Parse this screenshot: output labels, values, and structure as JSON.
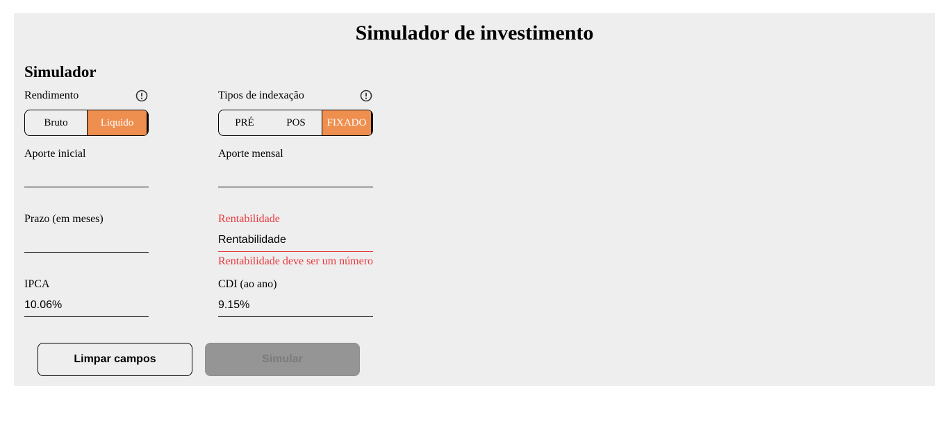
{
  "header": {
    "title": "Simulador de investimento"
  },
  "simulator": {
    "section_title": "Simulador",
    "rendimento": {
      "label": "Rendimento",
      "options": [
        "Bruto",
        "Liquido"
      ],
      "selected": "Liquido"
    },
    "indexacao": {
      "label": "Tipos de indexação",
      "options": [
        "PRÉ",
        "POS",
        "FIXADO"
      ],
      "selected": "FIXADO"
    },
    "fields": {
      "aporte_inicial": {
        "label": "Aporte inicial",
        "value": ""
      },
      "aporte_mensal": {
        "label": "Aporte mensal",
        "value": ""
      },
      "prazo": {
        "label": "Prazo (em meses)",
        "value": ""
      },
      "rentabilidade": {
        "label": "Rentabilidade",
        "value": "Rentabilidade",
        "error": "Rentabilidade deve ser um número"
      },
      "ipca": {
        "label": "IPCA",
        "value": "10.06%"
      },
      "cdi": {
        "label": "CDI (ao ano)",
        "value": "9.15%"
      }
    },
    "buttons": {
      "clear": "Limpar campos",
      "simulate": "Simular"
    }
  },
  "icons": {
    "rendimento_info": "info-icon",
    "indexacao_info": "info-icon"
  },
  "colors": {
    "accent": "#ef8f4f",
    "error": "#e8383d",
    "panel_bg": "#eeeeee",
    "disabled_button": "#959595"
  }
}
